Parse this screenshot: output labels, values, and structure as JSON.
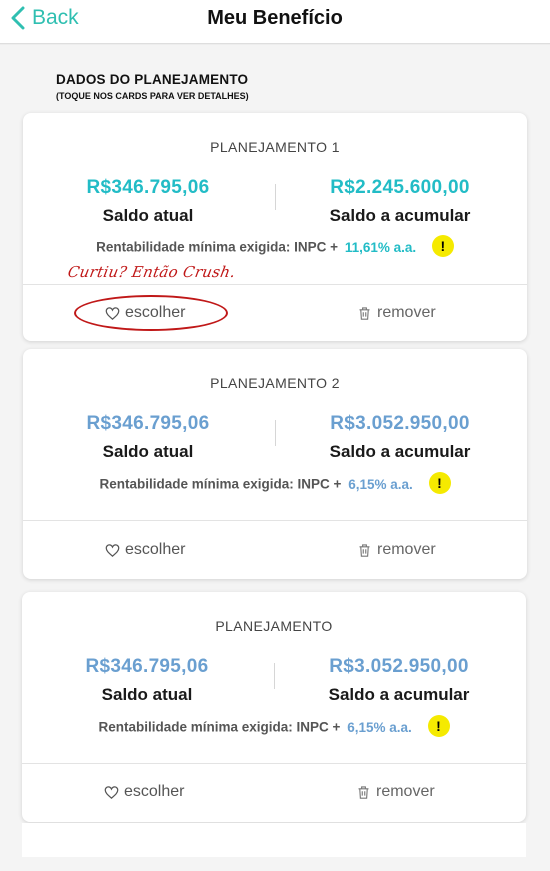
{
  "header": {
    "back_label": "Back",
    "title": "Meu Benefício"
  },
  "section": {
    "title": "DADOS DO PLANEJAMENTO",
    "subtitle": "(TOQUE NOS CARDS PARA VER DETALHES)"
  },
  "colors": {
    "accent": "#2fbfb1",
    "amount_teal": "#22bcc6",
    "amount_blue": "#6a9fd0",
    "warning": "#f5ea00",
    "annotation": "#c01818"
  },
  "cards": [
    {
      "title": "PLANEJAMENTO 1",
      "saldo_atual": "R$346.795,06",
      "saldo_atual_label": "Saldo atual",
      "saldo_acumular": "R$2.245.600,00",
      "saldo_acumular_label": "Saldo a acumular",
      "rent_text": "Rentabilidade mínima exigida: INPC +",
      "rate": "11,61% a.a.",
      "choose_label": "escolher",
      "remove_label": "remover"
    },
    {
      "title": "PLANEJAMENTO 2",
      "saldo_atual": "R$346.795,06",
      "saldo_atual_label": "Saldo atual",
      "saldo_acumular": "R$3.052.950,00",
      "saldo_acumular_label": "Saldo a acumular",
      "rent_text": "Rentabilidade mínima exigida: INPC +",
      "rate": "6,15% a.a.",
      "choose_label": "escolher",
      "remove_label": "remover"
    },
    {
      "title": "PLANEJAMENTO",
      "saldo_atual": "R$346.795,06",
      "saldo_atual_label": "Saldo atual",
      "saldo_acumular": "R$3.052.950,00",
      "saldo_acumular_label": "Saldo a acumular",
      "rent_text": "Rentabilidade mínima exigida: INPC +",
      "rate": "6,15% a.a.",
      "choose_label": "escolher",
      "remove_label": "remover"
    }
  ],
  "warning_symbol": "!",
  "annotation": {
    "text": "Curtiu? Então Crush."
  },
  "icons": {
    "back": "chevron-left-icon",
    "choose": "heart-icon",
    "remove": "trash-icon",
    "warning": "exclamation-icon"
  }
}
